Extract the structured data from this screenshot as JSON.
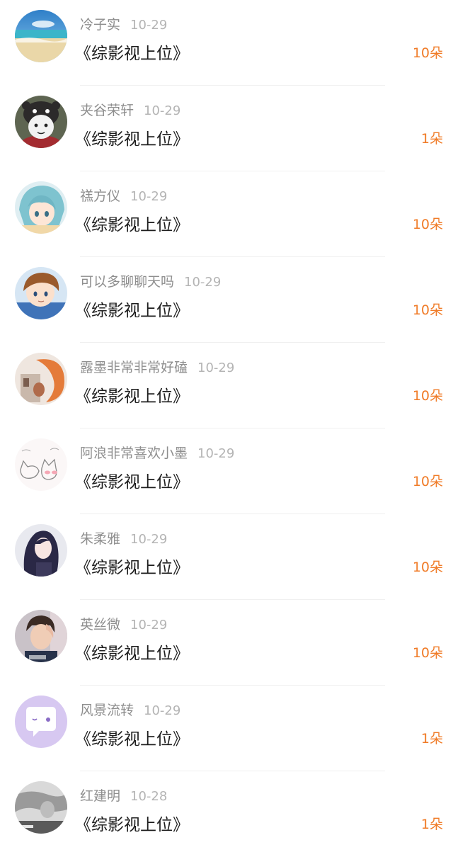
{
  "gift_list": {
    "items": [
      {
        "user": "冷子实",
        "date": "10-29",
        "book": "《综影视上位》",
        "amount": "10朵",
        "avatar_icon": "beach-avatar-icon"
      },
      {
        "user": "夹谷荣轩",
        "date": "10-29",
        "book": "《综影视上位》",
        "amount": "1朵",
        "avatar_icon": "cartoon-bear-hat-avatar-icon"
      },
      {
        "user": "禚方仪",
        "date": "10-29",
        "book": "《综影视上位》",
        "amount": "10朵",
        "avatar_icon": "anime-blue-hair-avatar-icon"
      },
      {
        "user": "可以多聊聊天吗",
        "date": "10-29",
        "book": "《综影视上位》",
        "amount": "10朵",
        "avatar_icon": "anime-brown-hair-avatar-icon"
      },
      {
        "user": "露墨非常非常好磕",
        "date": "10-29",
        "book": "《综影视上位》",
        "amount": "10朵",
        "avatar_icon": "fox-tail-avatar-icon"
      },
      {
        "user": "阿浪非常喜欢小墨",
        "date": "10-29",
        "book": "《综影视上位》",
        "amount": "10朵",
        "avatar_icon": "sketch-cats-avatar-icon"
      },
      {
        "user": "朱柔雅",
        "date": "10-29",
        "book": "《综影视上位》",
        "amount": "10朵",
        "avatar_icon": "anime-dark-hair-girl-avatar-icon"
      },
      {
        "user": "英丝微",
        "date": "10-29",
        "book": "《综影视上位》",
        "amount": "10朵",
        "avatar_icon": "portrait-photo-avatar-icon"
      },
      {
        "user": "风景流转",
        "date": "10-29",
        "book": "《综影视上位》",
        "amount": "1朵",
        "avatar_icon": "chat-bubble-avatar-icon"
      },
      {
        "user": "红建明",
        "date": "10-28",
        "book": "《综影视上位》",
        "amount": "1朵",
        "avatar_icon": "gray-photo-avatar-icon"
      }
    ]
  },
  "colors": {
    "amount": "#f07b27",
    "name": "#8e8e8e",
    "date": "#b4b4b4",
    "book": "#1e1e1e",
    "divider": "#f0f0f0",
    "chat_avatar_bg": "#d7c8f1"
  }
}
